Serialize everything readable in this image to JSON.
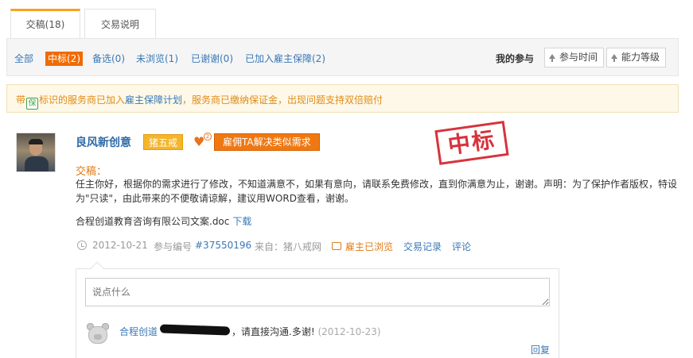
{
  "tabs": [
    {
      "label": "交稿(18)"
    },
    {
      "label": "交易说明"
    }
  ],
  "filters": [
    {
      "label": "全部"
    },
    {
      "label": "中标(2)"
    },
    {
      "label": "备选(0)"
    },
    {
      "label": "未浏览(1)"
    },
    {
      "label": "已谢谢(0)"
    },
    {
      "label": "已加入雇主保障(2)"
    }
  ],
  "sort": {
    "title": "我的参与",
    "buttons": [
      {
        "label": "参与时间"
      },
      {
        "label": "能力等级"
      }
    ]
  },
  "notice": {
    "prefix": "带",
    "icon_char": "保",
    "part1": "标识的服务商已加入",
    "link": "雇主保障计划",
    "part2": "，服务商已缴纳保证金，出现问题支持双倍赔付"
  },
  "submission": {
    "username": "良风新创意",
    "level": "猪五戒",
    "heart_count": "2",
    "hire_button": "雇佣TA解决类似需求",
    "stamp": "中标",
    "section_label": "交稿：",
    "content": "任主你好，根据你的需求进行了修改，不知道满意不，如果有意向，请联系免费修改，直到你满意为止，谢谢。声明：为了保护作者版权，特设为\"只读\"，由此带来的不便敬请谅解，建议用WORD查看，谢谢。",
    "attachment_name": "合程创道教育咨询有限公司文案.doc",
    "download_label": "下载",
    "meta": {
      "date": "2012-10-21",
      "ref_label": "参与编号",
      "ref_no": "#37550196",
      "source": "来自：猪八戒网",
      "viewed": "雇主已浏览",
      "records": "交易记录",
      "comment": "评论"
    }
  },
  "comment_box": {
    "placeholder": "说点什么",
    "comment": {
      "author": "合程创道",
      "text": "，请直接沟通.多谢!",
      "date": "(2012-10-23)"
    },
    "reply_label": "回复"
  }
}
